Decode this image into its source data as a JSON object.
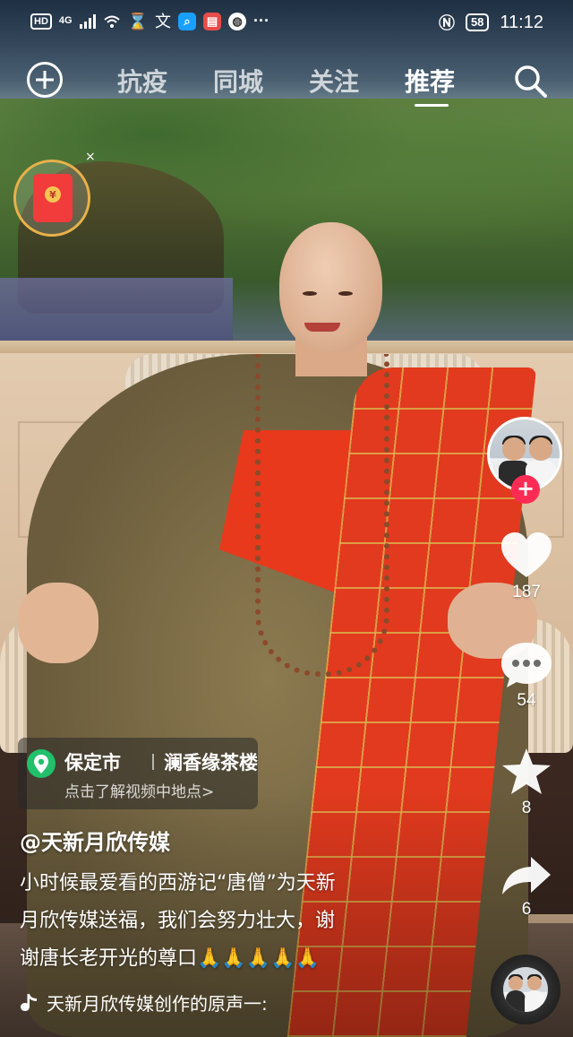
{
  "status_bar": {
    "hd": "HD",
    "network": "4G",
    "time": "11:12",
    "battery": "58"
  },
  "top_nav": {
    "tabs": [
      {
        "label": "抗疫"
      },
      {
        "label": "同城"
      },
      {
        "label": "关注"
      },
      {
        "label": "推荐"
      }
    ],
    "active_tab": "推荐"
  },
  "red_packet": {
    "coin_symbol": "¥",
    "close": "×"
  },
  "actions": {
    "likes": "187",
    "comments": "54",
    "favorites": "8",
    "shares": "6",
    "follow_symbol": "+"
  },
  "location": {
    "city": "保定市",
    "place": "澜香缘茶楼",
    "hint": "点击了解视频中地点>"
  },
  "post": {
    "author": "@天新月欣传媒",
    "caption_lines": [
      "小时候最爱看的西游记“唐僧”为天新",
      "月欣传媒送福，我们会努力壮大，谢",
      "谢唐长老开光的尊口🙏🙏🙏🙏🙏"
    ],
    "music": "天新月欣传媒创作的原声一:"
  },
  "colors": {
    "accent": "#fe2c55",
    "location_pin": "#22c06b",
    "packet_red": "#f23b3b",
    "packet_ring": "#e8b04a"
  }
}
